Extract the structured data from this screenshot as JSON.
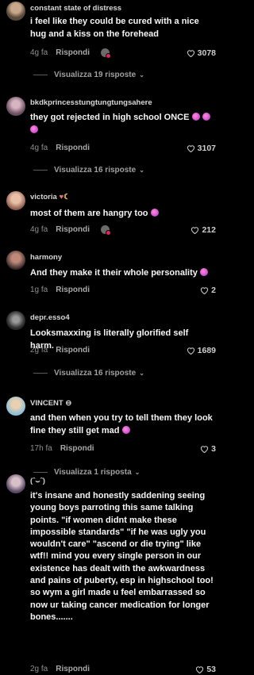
{
  "ui": {
    "reply_label": "Rispondi",
    "heart_icon": "heart-outline-icon"
  },
  "comments": [
    {
      "username": "constant state of distress",
      "text": "i feel like they could be cured with a nice hug and a kiss on the forehead",
      "time": "4g fa",
      "likes": "3078",
      "replies": "Visualizza 19 risposte",
      "avatar_color": "#6a5a4a"
    },
    {
      "username": "bkdkprincesstungtungtungsahere",
      "text": "they got rejected in high school ONCE",
      "time": "4g fa",
      "likes": "3107",
      "replies": "Visualizza 16 risposte",
      "avatar_color": "#8a6f7a"
    },
    {
      "username": "victoria",
      "text": "most of them are hangry too",
      "time": "4g fa",
      "likes": "212",
      "avatar_color": "#c79a86"
    },
    {
      "username": "harmony",
      "text": "And they make it their whole personality",
      "time": "1g fa",
      "likes": "2",
      "avatar_color": "#5a4040"
    },
    {
      "username": "depr.esso4",
      "text": "Looksmaxxing is literally glorified self harm.",
      "time": "2g fa",
      "likes": "1689",
      "replies": "Visualizza 16 risposte",
      "avatar_color": "#3a3a3a"
    },
    {
      "username": "VINCENT ⊖",
      "text": "and then when you try to tell them they look fine they still get mad",
      "time": "17h fa",
      "likes": "3",
      "replies": "Visualizza 1 risposta",
      "avatar_color": "#b8d8e8"
    },
    {
      "username": "(ˆ⌣ˆ)",
      "text": "it's insane and honestly saddening seeing young boys parroting this same talking points. \"if women didnt make these impossible standards\" \"if he was ugly you wouldn't care\" \"ascend or die trying\" like wtf!! mind you every single person in our existence has dealt with the awkwardness and pains of puberty, esp in highschool too! so wym a girl made u feel embarrassed so now ur taking cancer medication for longer bones.......",
      "time": "2g fa",
      "likes": "53",
      "avatar_color": "#9a86a6"
    }
  ]
}
